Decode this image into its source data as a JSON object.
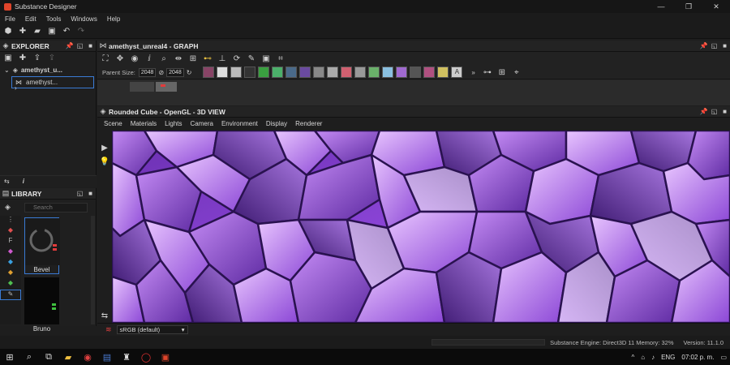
{
  "window": {
    "title": "Substance Designer",
    "controls": [
      "—",
      "❐",
      "✕"
    ]
  },
  "menu": [
    "File",
    "Edit",
    "Tools",
    "Windows",
    "Help"
  ],
  "explorer": {
    "title": "EXPLORER",
    "package": "amethyst_u...",
    "graph": "amethyst..."
  },
  "library": {
    "title": "LIBRARY",
    "search_placeholder": "Search",
    "items": [
      {
        "label": "Bevel"
      },
      {
        "label": "Bruno"
      }
    ]
  },
  "graph": {
    "title": "amethyst_unreal4 - GRAPH",
    "parent_size_label": "Parent Size:",
    "width_value": "2048",
    "height_value": "2048"
  },
  "view3d": {
    "title": "Rounded Cube - OpenGL - 3D VIEW",
    "menu": [
      "Scene",
      "Materials",
      "Lights",
      "Camera",
      "Environment",
      "Display",
      "Renderer"
    ],
    "colorspace": "sRGB (default)"
  },
  "status": {
    "text": "Substance Engine: Direct3D 11  Memory: 32%",
    "version": "Version: 11.1.0"
  },
  "taskbar": {
    "time": "07:02 p. m.",
    "lang": "ENG"
  },
  "colors": {
    "accent": "#3a7bd5",
    "amethyst": "#8a3fd0",
    "app_brand": "#e0452b"
  }
}
